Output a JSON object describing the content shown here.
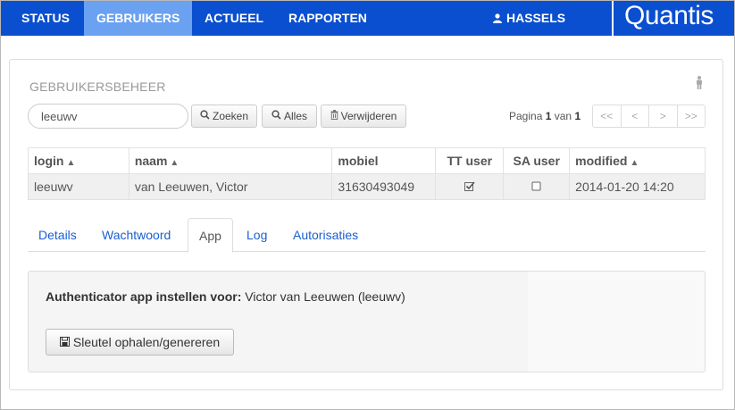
{
  "nav": {
    "items": [
      {
        "label": "STATUS"
      },
      {
        "label": "GEBRUIKERS"
      },
      {
        "label": "ACTUEEL"
      },
      {
        "label": "RAPPORTEN"
      }
    ],
    "user": "HASSELS",
    "brand": "Quantis",
    "colors": {
      "bar": "#0a4fcf",
      "active": "#6aa1f1"
    }
  },
  "panel": {
    "title": "GEBRUIKERSBEHEER",
    "search_value": "leeuwv",
    "buttons": {
      "search": "Zoeken",
      "all": "Alles",
      "delete": "Verwijderen"
    },
    "pager": {
      "label_prefix": "Pagina",
      "current": "1",
      "label_mid": "van",
      "total": "1",
      "buttons": [
        "<<",
        "<",
        ">",
        ">>"
      ]
    }
  },
  "table": {
    "headers": [
      "login",
      "naam",
      "mobiel",
      "TT user",
      "SA user",
      "modified"
    ],
    "rows": [
      {
        "login": "leeuwv",
        "naam": "van Leeuwen, Victor",
        "mobiel": "31630493049",
        "tt_user": true,
        "sa_user": false,
        "modified": "2014-01-20 14:20"
      }
    ]
  },
  "tabs": [
    "Details",
    "Wachtwoord",
    "App",
    "Log",
    "Autorisaties"
  ],
  "active_tab": "App",
  "app": {
    "heading_label": "Authenticator app instellen voor:",
    "heading_value": "Victor van Leeuwen (leeuwv)",
    "key_button": "Sleutel ophalen/genereren"
  },
  "icons": [
    "user-icon",
    "person-icon",
    "search-icon",
    "trash-icon",
    "sort-icon",
    "checked-checkbox-icon",
    "empty-checkbox-icon",
    "save-icon"
  ]
}
